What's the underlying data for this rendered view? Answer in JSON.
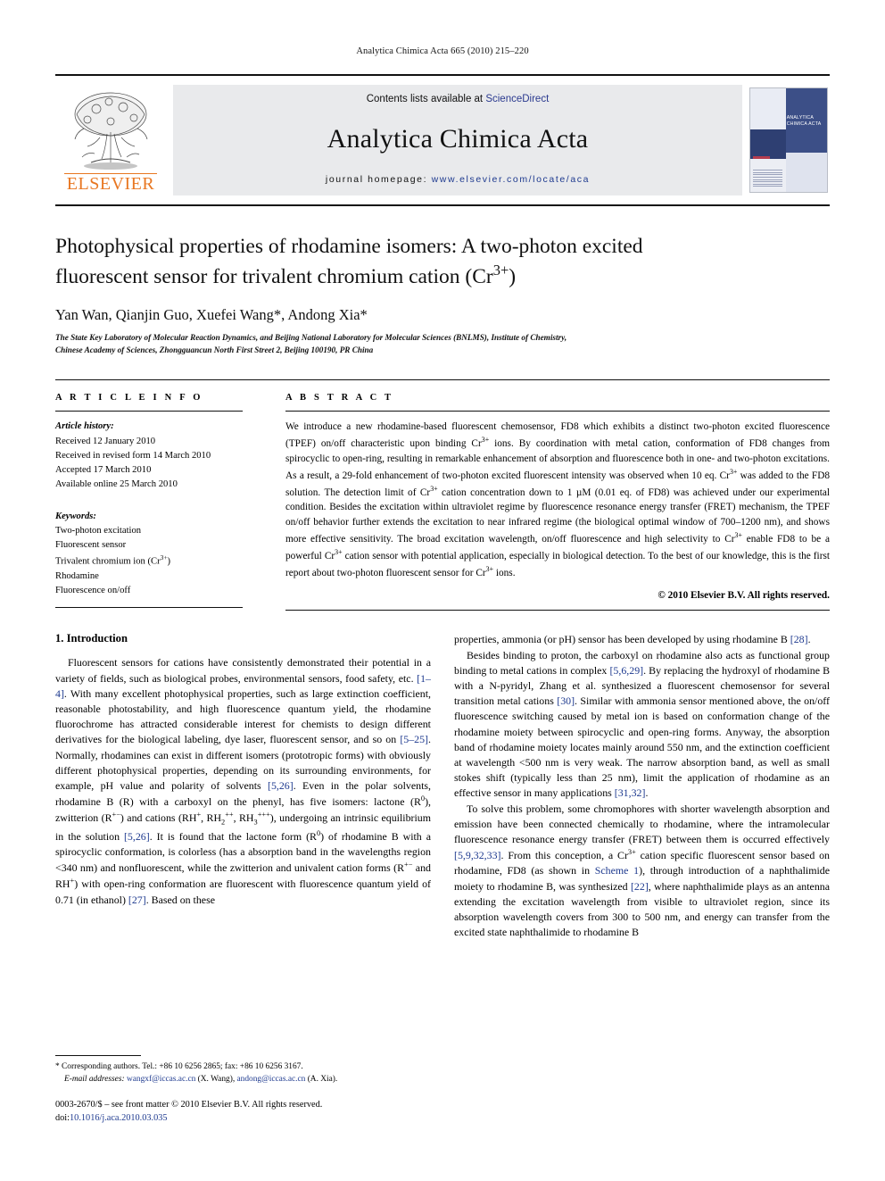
{
  "running_head": "Analytica Chimica Acta 665 (2010) 215–220",
  "masthead": {
    "publisher": "ELSEVIER",
    "contents_prefix": "Contents lists available at ",
    "contents_link": "ScienceDirect",
    "journal_name": "Analytica Chimica Acta",
    "homepage_prefix": "journal homepage: ",
    "homepage_url": "www.elsevier.com/locate/aca",
    "cover_title_line1": "ANALYTICA",
    "cover_title_line2": "CHIMICA ACTA"
  },
  "article": {
    "title_line1": "Photophysical properties of rhodamine isomers: A two-photon excited",
    "title_line2_pre": "fluorescent sensor for trivalent chromium cation (Cr",
    "title_line2_sup": "3+",
    "title_line2_post": ")",
    "authors_plain": "Yan Wan, Qianjin Guo, Xuefei Wang*, Andong Xia*",
    "affiliation_line1": "The State Key Laboratory of Molecular Reaction Dynamics, and Beijing National Laboratory for Molecular Sciences (BNLMS), Institute of Chemistry,",
    "affiliation_line2": "Chinese Academy of Sciences, Zhongguancun North First Street 2, Beijing 100190, PR China"
  },
  "article_info": {
    "heading": "A R T I C L E   I N F O",
    "history_label": "Article history:",
    "history": [
      "Received 12 January 2010",
      "Received in revised form 14 March 2010",
      "Accepted 17 March 2010",
      "Available online 25 March 2010"
    ],
    "keywords_label": "Keywords:",
    "keywords": [
      "Two-photon excitation",
      "Fluorescent sensor",
      "Trivalent chromium ion (Cr3+)",
      "Rhodamine",
      "Fluorescence on/off"
    ]
  },
  "abstract": {
    "heading": "A B S T R A C T",
    "text": "We introduce a new rhodamine-based fluorescent chemosensor, FD8 which exhibits a distinct two-photon excited fluorescence (TPEF) on/off characteristic upon binding Cr3+ ions. By coordination with metal cation, conformation of FD8 changes from spirocyclic to open-ring, resulting in remarkable enhancement of absorption and fluorescence both in one- and two-photon excitations. As a result, a 29-fold enhancement of two-photon excited fluorescent intensity was observed when 10 eq. Cr3+ was added to the FD8 solution. The detection limit of Cr3+ cation concentration down to 1 μM (0.01 eq. of FD8) was achieved under our experimental condition. Besides the excitation within ultraviolet regime by fluorescence resonance energy transfer (FRET) mechanism, the TPEF on/off behavior further extends the excitation to near infrared regime (the biological optimal window of 700–1200 nm), and shows more effective sensitivity. The broad excitation wavelength, on/off fluorescence and high selectivity to Cr3+ enable FD8 to be a powerful Cr3+ cation sensor with potential application, especially in biological detection. To the best of our knowledge, this is the first report about two-photon fluorescent sensor for Cr3+ ions.",
    "copyright": "© 2010 Elsevier B.V. All rights reserved."
  },
  "introduction": {
    "heading": "1.  Introduction",
    "left_paragraph": "Fluorescent sensors for cations have consistently demonstrated their potential in a variety of fields, such as biological probes, environmental sensors, food safety, etc. [1–4]. With many excellent photophysical properties, such as large extinction coefficient, reasonable photostability, and high fluorescence quantum yield, the rhodamine fluorochrome has attracted considerable interest for chemists to design different derivatives for the biological labeling, dye laser, fluorescent sensor, and so on [5–25]. Normally, rhodamines can exist in different isomers (prototropic forms) with obviously different photophysical properties, depending on its surrounding environments, for example, pH value and polarity of solvents [5,26]. Even in the polar solvents, rhodamine B (R) with a carboxyl on the phenyl, has five isomers: lactone (R0), zwitterion (R+−) and cations (RH+, RH2++, RH3+++), undergoing an intrinsic equilibrium in the solution [5,26]. It is found that the lactone form (R0) of rhodamine B with a spirocyclic conformation, is colorless (has a absorption band in the wavelengths region <340 nm) and nonfluorescent, while the zwitterion and univalent cation forms (R+− and RH+) with open-ring conformation are fluorescent with fluorescence quantum yield of 0.71 (in ethanol) [27]. Based on these",
    "right_paragraph_1": "properties, ammonia (or pH) sensor has been developed by using rhodamine B [28].",
    "right_paragraph_2": "Besides binding to proton, the carboxyl on rhodamine also acts as functional group binding to metal cations in complex [5,6,29]. By replacing the hydroxyl of rhodamine B with a N-pyridyl, Zhang et al. synthesized a fluorescent chemosensor for several transition metal cations [30]. Similar with ammonia sensor mentioned above, the on/off fluorescence switching caused by metal ion is based on conformation change of the rhodamine moiety between spirocyclic and open-ring forms. Anyway, the absorption band of rhodamine moiety locates mainly around 550 nm, and the extinction coefficient at wavelength <500 nm is very weak. The narrow absorption band, as well as small stokes shift (typically less than 25 nm), limit the application of rhodamine as an effective sensor in many applications [31,32].",
    "right_paragraph_3": "To solve this problem, some chromophores with shorter wavelength absorption and emission have been connected chemically to rhodamine, where the intramolecular fluorescence resonance energy transfer (FRET) between them is occurred effectively [5,9,32,33]. From this conception, a Cr3+ cation specific fluorescent sensor based on rhodamine, FD8 (as shown in Scheme 1), through introduction of a naphthalimide moiety to rhodamine B, was synthesized [22], where naphthalimide plays as an antenna extending the excitation wavelength from visible to ultraviolet region, since its absorption wavelength covers from 300 to 500 nm, and energy can transfer from the excited state naphthalimide to rhodamine B"
  },
  "footer": {
    "corresponding": "* Corresponding authors. Tel.: +86 10 6256 2865; fax: +86 10 6256 3167.",
    "email_label": "E-mail addresses:",
    "email1": "wangxf@iccas.ac.cn",
    "email1_owner": "(X. Wang),",
    "email2": "andong@iccas.ac.cn",
    "email2_owner": "(A. Xia).",
    "issn_line": "0003-2670/$ – see front matter © 2010 Elsevier B.V. All rights reserved.",
    "doi_label": "doi:",
    "doi_value": "10.1016/j.aca.2010.03.035"
  },
  "colors": {
    "elsevier_orange": "#E87722",
    "link_blue": "#1e3a8f",
    "masthead_grey": "#e9eaec"
  }
}
